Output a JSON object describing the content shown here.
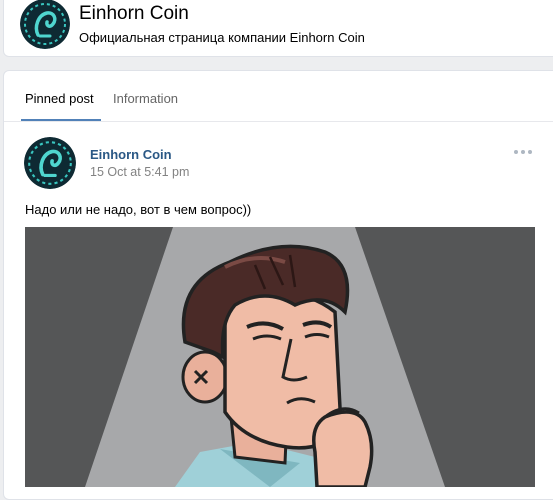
{
  "header": {
    "title": "Einhorn Coin",
    "subtitle": "Официальная страница компании Einhorn Coin"
  },
  "tabs": [
    {
      "label": "Pinned post",
      "active": true
    },
    {
      "label": "Information",
      "active": false
    }
  ],
  "post": {
    "author": "Einhorn Coin",
    "date": "15 Oct at 5:41 pm",
    "text": "Надо или не надо, вот в чем вопрос))"
  },
  "colors": {
    "page_bg": "#edeef0",
    "link": "#2a5885",
    "tab_underline": "#5181b8",
    "muted": "#828282"
  }
}
